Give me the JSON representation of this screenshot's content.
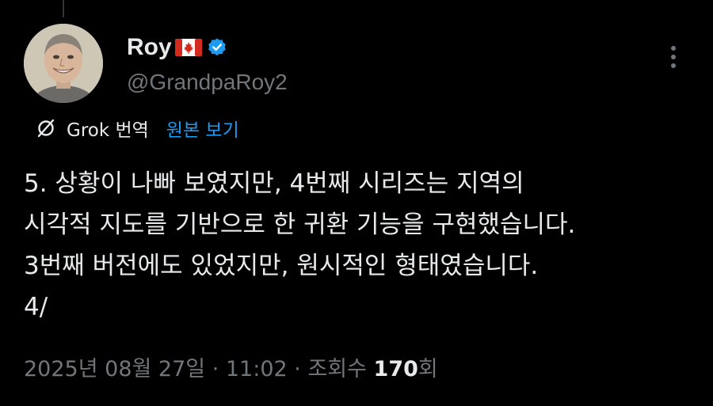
{
  "tweet": {
    "author": {
      "display_name": "Roy",
      "handle": "@GrandpaRoy2",
      "flag_icon": "canada-flag-icon",
      "verified_icon": "verified-badge-icon"
    },
    "translation": {
      "label": "Grok 번역",
      "view_original": "원본 보기"
    },
    "text_lines": [
      "5. 상황이 나빠 보였지만, 4번째 시리즈는 지역의",
      "시각적 지도를 기반으로 한 귀환 기능을 구현했습니다.",
      "3번째 버전에도 있었지만, 원시적인 형태였습니다.",
      "4/"
    ],
    "meta": {
      "date": "2025년 08월 27일",
      "separator": " · ",
      "time": "11:02",
      "views_label": "조회수 ",
      "views_count": "170",
      "views_suffix": "회"
    }
  },
  "colors": {
    "background": "#000000",
    "text_primary": "#e7e9ea",
    "text_secondary": "#71767b",
    "accent": "#1d9bf0",
    "thread_line": "#333639"
  }
}
